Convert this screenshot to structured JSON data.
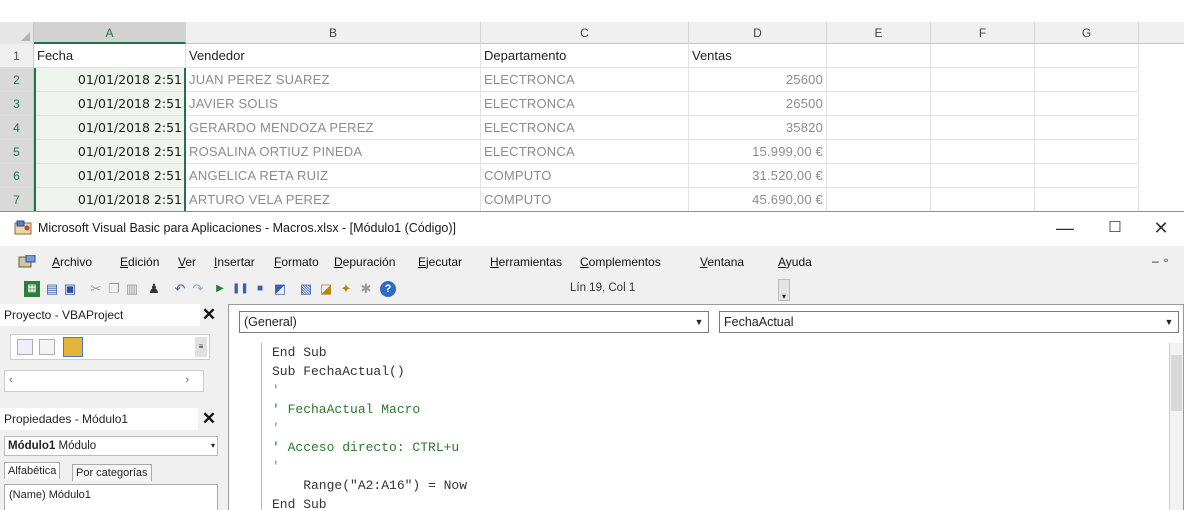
{
  "sheet": {
    "columns": [
      "A",
      "B",
      "C",
      "D",
      "E",
      "F",
      "G"
    ],
    "rows": [
      {
        "num": "1",
        "a": "Fecha",
        "b": "Vendedor",
        "c": "Departamento",
        "d": "Ventas"
      },
      {
        "num": "2",
        "a": "01/01/2018 2:51",
        "b": "JUAN PEREZ SUAREZ",
        "c": "ELECTRONCA",
        "d": "25600"
      },
      {
        "num": "3",
        "a": "01/01/2018 2:51",
        "b": "JAVIER SOLIS",
        "c": "ELECTRONCA",
        "d": "26500"
      },
      {
        "num": "4",
        "a": "01/01/2018 2:51",
        "b": "GERARDO MENDOZA PEREZ",
        "c": "ELECTRONCA",
        "d": "35820"
      },
      {
        "num": "5",
        "a": "01/01/2018 2:51",
        "b": "ROSALINA ORTIUZ PINEDA",
        "c": "ELECTRONCA",
        "d": "15.999,00 €"
      },
      {
        "num": "6",
        "a": "01/01/2018 2:51",
        "b": "ANGELICA RETA RUIZ",
        "c": "COMPUTO",
        "d": "31.520,00 €"
      },
      {
        "num": "7",
        "a": "01/01/2018 2:51",
        "b": "ARTURO VELA PEREZ",
        "c": "COMPUTO",
        "d": "45.690,00 €"
      }
    ]
  },
  "vbe": {
    "title": "Microsoft Visual Basic para Aplicaciones - Macros.xlsx - [Módulo1 (Código)]",
    "win_buttons": {
      "minimize": "—",
      "maximize": "☐",
      "close": "✕"
    },
    "menu": [
      "Archivo",
      "Edición",
      "Ver",
      "Insertar",
      "Formato",
      "Depuración",
      "Ejecutar",
      "Herramientas",
      "Complementos",
      "Ventana",
      "Ayuda"
    ],
    "cursor_pos": "Lín 19, Col 1",
    "project_title": "Proyecto - VBAProject",
    "props_title": "Propiedades - Módulo1",
    "props_object": "Módulo1",
    "props_object_type": "Módulo",
    "props_tabs": [
      "Alfabética",
      "Por categorías"
    ],
    "props_name_row": "(Name) Módulo1",
    "combo_object": "(General)",
    "combo_proc": "FechaActual",
    "code_lines": [
      {
        "text": "End Sub",
        "kind": "code"
      },
      {
        "text": "Sub FechaActual()",
        "kind": "code"
      },
      {
        "text": "'",
        "kind": "dot"
      },
      {
        "text": "' FechaActual Macro",
        "kind": "cm"
      },
      {
        "text": "'",
        "kind": "dot"
      },
      {
        "text": "' Acceso directo: CTRL+u",
        "kind": "cm"
      },
      {
        "text": "'",
        "kind": "dot"
      },
      {
        "text": "    Range(\"A2:A16\") = Now",
        "kind": "code"
      },
      {
        "text": "End Sub",
        "kind": "code"
      }
    ],
    "colors": {
      "comment": "#2a7a2a",
      "excel_green": "#217346"
    }
  }
}
